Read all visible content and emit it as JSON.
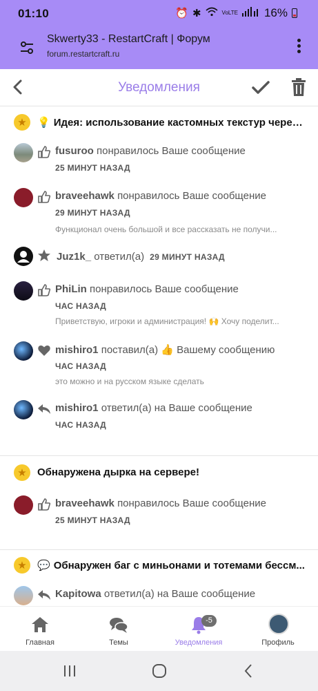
{
  "status_bar": {
    "time": "01:10",
    "battery": "16%",
    "network": "VoLTE"
  },
  "browser": {
    "title": "Skwerty33 - RestartCraft | Форум",
    "url": "forum.restartcraft.ru"
  },
  "header": {
    "title": "Уведомления"
  },
  "groups": [
    {
      "emoji": "💡",
      "title": "Идея: использование кастомных текстур через...",
      "items": [
        {
          "user": "fusuroo",
          "action": "понравилось Ваше сообщение",
          "time": "25 МИНУТ НАЗАД",
          "snippet": ""
        },
        {
          "user": "braveehawk",
          "action": "понравилось Ваше сообщение",
          "time": "29 МИНУТ НАЗАД",
          "snippet": "Функционал очень большой и все рассказать не получи..."
        },
        {
          "user": "Juz1k_",
          "action": "ответил(а)",
          "time": "29 МИНУТ НАЗАД",
          "snippet": ""
        },
        {
          "user": "PhiLin",
          "action": "понравилось Ваше сообщение",
          "time": "ЧАС НАЗАД",
          "snippet": "Приветствую, игроки и администрация! 🙌 Хочу поделит..."
        },
        {
          "user": "mishiro1",
          "action": "поставил(а) 👍 Вашему сообщению",
          "time": "ЧАС НАЗАД",
          "snippet": "это можно и на русском языке сделать"
        },
        {
          "user": "mishiro1",
          "action": "ответил(а) на Ваше сообщение",
          "time": "ЧАС НАЗАД",
          "snippet": ""
        }
      ]
    },
    {
      "emoji": "",
      "title": "Обнаружена дырка на сервере!",
      "items": [
        {
          "user": "braveehawk",
          "action": "понравилось Ваше сообщение",
          "time": "25 МИНУТ НАЗАД",
          "snippet": ""
        }
      ]
    },
    {
      "emoji": "💬",
      "title": "Обнаружен баг с миньонами и тотемами бессм...",
      "items": [
        {
          "user": "Kapitowa",
          "action": "ответил(а) на Ваше сообщение",
          "time": "",
          "snippet": ""
        }
      ]
    }
  ],
  "bottom_nav": {
    "home": "Главная",
    "topics": "Темы",
    "notifications": "Уведомления",
    "notif_badge": "-5",
    "profile": "Профиль"
  },
  "colors": {
    "accent": "#9a7de8",
    "header_bg": "#a78bf6",
    "star": "#f7c92c"
  }
}
